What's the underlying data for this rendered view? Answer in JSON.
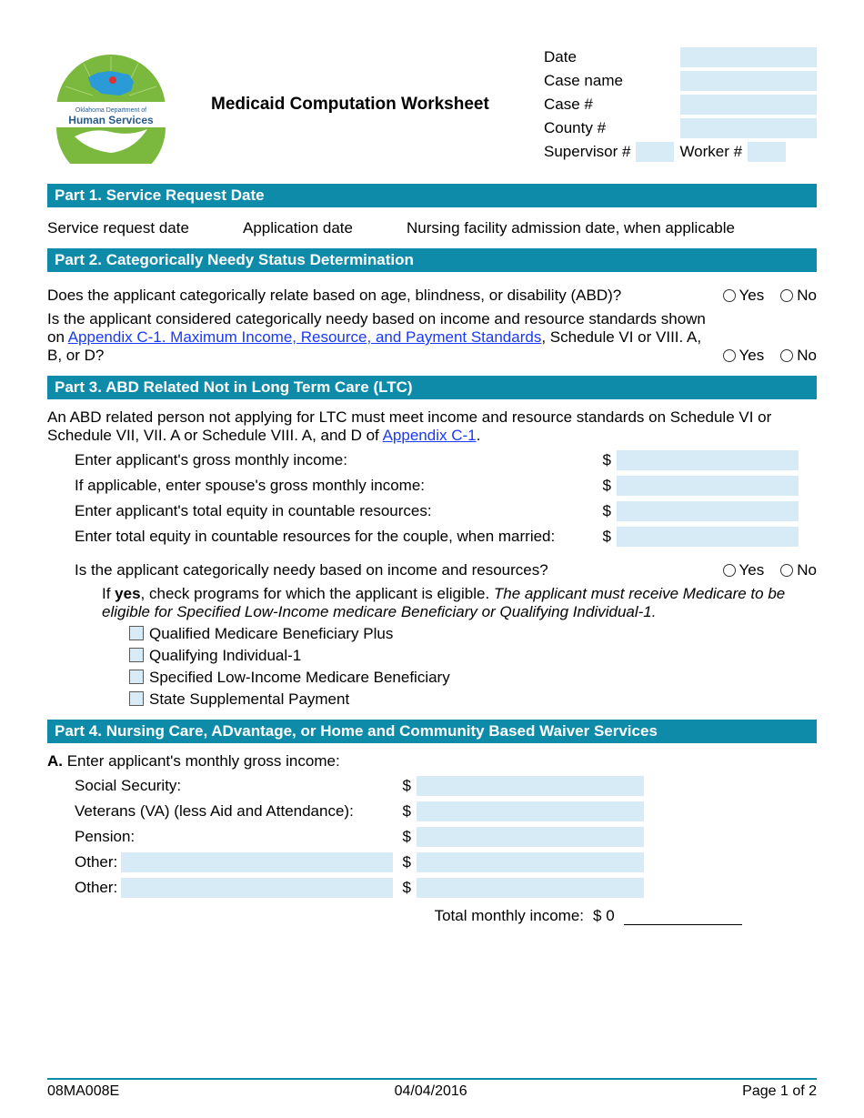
{
  "agency": {
    "line1": "Oklahoma Department of",
    "line2": "Human Services"
  },
  "title": "Medicaid Computation Worksheet",
  "meta": {
    "date_label": "Date",
    "case_name_label": "Case name",
    "case_no_label": "Case #",
    "county_no_label": "County #",
    "supervisor_no_label": "Supervisor #",
    "worker_no_label": "Worker #"
  },
  "parts": {
    "p1": {
      "heading": "Part 1. Service Request Date",
      "service_request_label": "Service request date",
      "application_date_label": "Application date",
      "admission_date_label": "Nursing facility admission date, when applicable"
    },
    "p2": {
      "heading": "Part 2. Categorically Needy Status Determination",
      "q1": "Does the applicant categorically relate based on age, blindness, or disability (ABD)?",
      "q2_a": "Is the applicant considered categorically needy based on income and resource standards shown on ",
      "q2_link": "Appendix C-1. Maximum Income, Resource, and Payment Standards",
      "q2_b": ", Schedule VI or VIII. A, B, or D?"
    },
    "p3": {
      "heading": "Part 3. ABD Related Not in Long Term Care (LTC)",
      "intro_a": "An ABD related person not applying for LTC must meet income and resource standards on Schedule VI or Schedule VII, VII. A or Schedule VIII. A, and D of ",
      "intro_link": "Appendix C-1",
      "intro_b": ".",
      "r1": "Enter applicant's gross monthly income:",
      "r2": "If applicable, enter spouse's gross monthly income:",
      "r3": "Enter applicant's total equity in countable resources:",
      "r4": "Enter total equity in countable resources for the couple, when married:",
      "q": "Is the applicant categorically needy based on income and resources?",
      "ifyes_a": "If ",
      "ifyes_bold": "yes",
      "ifyes_b": ", check programs for which the applicant is eligible. ",
      "ifyes_ital": "The applicant must receive Medicare to be eligible for Specified Low-Income medicare Beneficiary or Qualifying Individual-1.",
      "programs": [
        "Qualified Medicare Beneficiary Plus",
        "Qualifying Individual-1",
        "Specified Low-Income Medicare Beneficiary",
        "State Supplemental Payment"
      ]
    },
    "p4": {
      "heading": "Part 4. Nursing Care, ADvantage, or Home and Community Based Waiver Services",
      "a_label": "A.",
      "a_text": " Enter applicant's monthly gross income:",
      "rows": {
        "ss": "Social Security:",
        "va": "Veterans (VA) (less Aid and Attendance):",
        "pension": "Pension:",
        "other": "Other:"
      },
      "total_label": "Total monthly income:",
      "total_prefix": "$",
      "total_value": "0"
    }
  },
  "common": {
    "yes": "Yes",
    "no": "No",
    "dollar": "$"
  },
  "footer": {
    "form_no": "08MA008E",
    "date": "04/04/2016",
    "page": "Page 1 of 2"
  }
}
